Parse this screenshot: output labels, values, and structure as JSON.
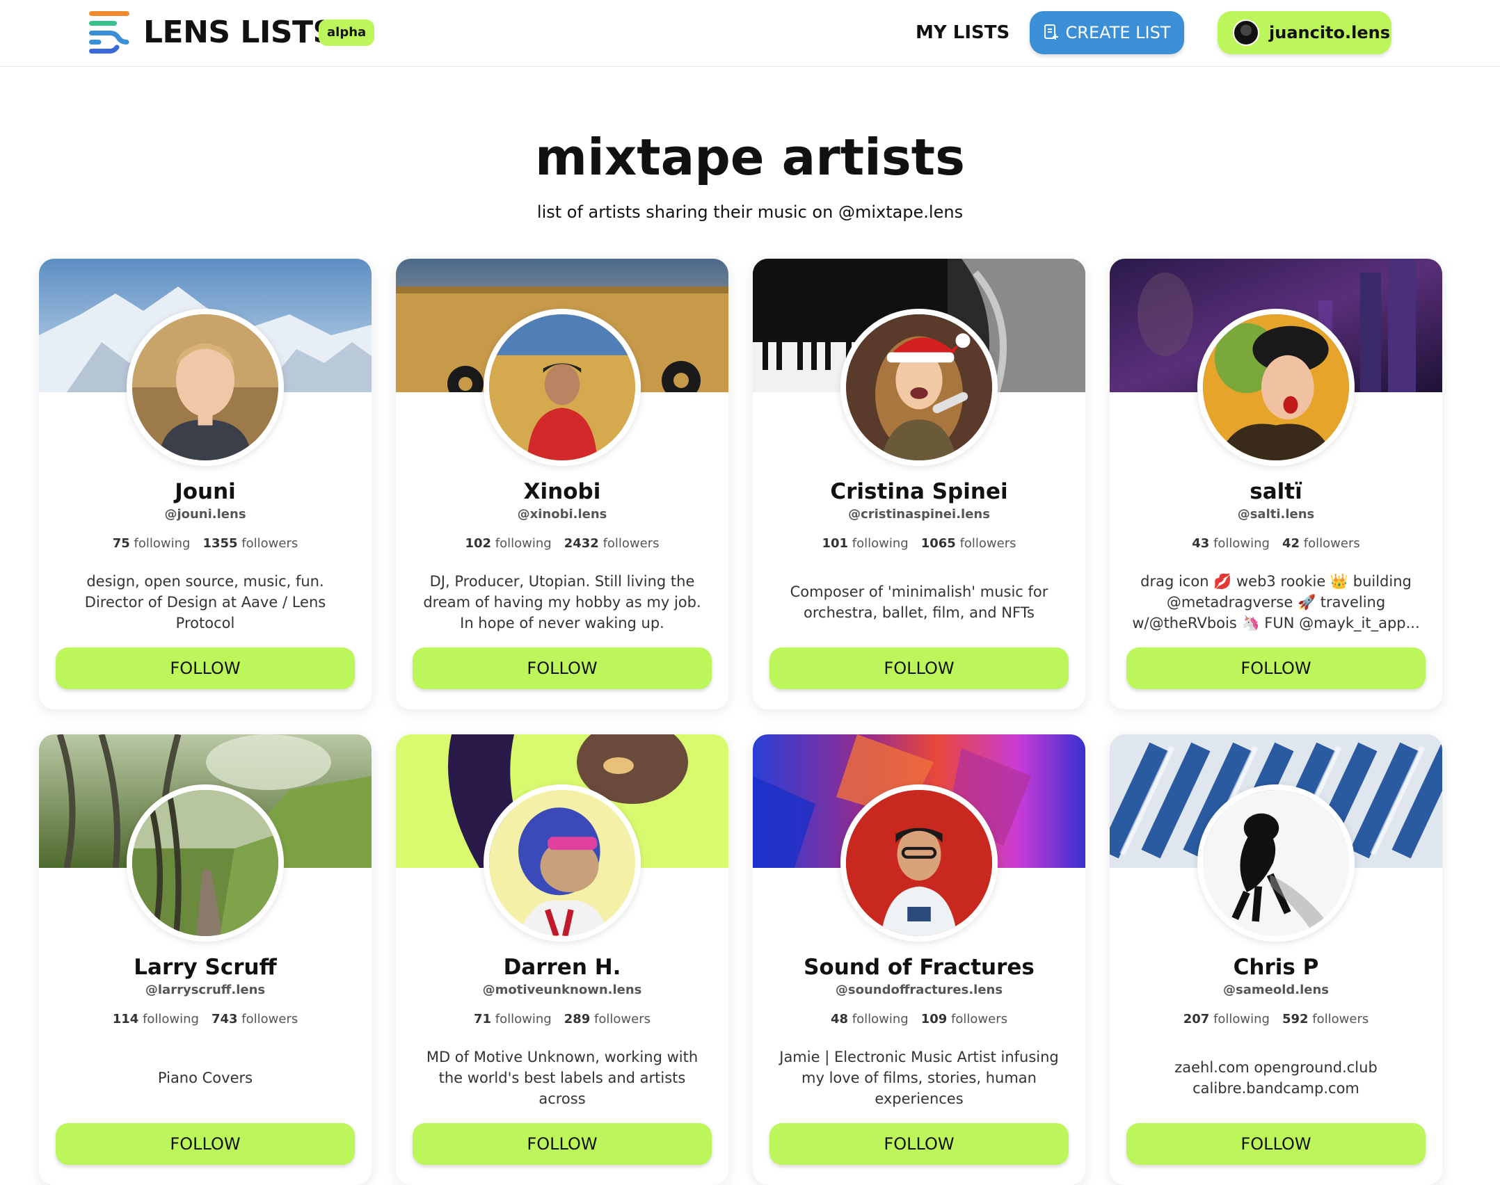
{
  "header": {
    "brand": "LENS LISTS",
    "badge": "alpha",
    "nav_my_lists": "MY LISTS",
    "create_list": "CREATE LIST",
    "user_handle": "juancito.lens",
    "colors": {
      "accent_green": "#bdf65a",
      "primary_blue": "#3b8fd6"
    }
  },
  "list": {
    "title": "mixtape artists",
    "description": "list of artists sharing their music on @mixtape.lens"
  },
  "cards": [
    {
      "name": "Jouni",
      "handle": "@jouni.lens",
      "following": "75",
      "followers": "1355",
      "following_label": "following",
      "followers_label": "followers",
      "bio": "design, open source, music, fun. Director of Design at Aave / Lens Protocol",
      "follow_label": "FOLLOW"
    },
    {
      "name": "Xinobi",
      "handle": "@xinobi.lens",
      "following": "102",
      "followers": "2432",
      "following_label": "following",
      "followers_label": "followers",
      "bio": "DJ, Producer, Utopian. Still living the dream of having my hobby as my job. In hope of never waking up.",
      "follow_label": "FOLLOW"
    },
    {
      "name": "Cristina Spinei",
      "handle": "@cristinaspinei.lens",
      "following": "101",
      "followers": "1065",
      "following_label": "following",
      "followers_label": "followers",
      "bio": "Composer of 'minimalish' music for orchestra, ballet, film, and NFTs",
      "follow_label": "FOLLOW"
    },
    {
      "name": "saltï",
      "handle": "@salti.lens",
      "following": "43",
      "followers": "42",
      "following_label": "following",
      "followers_label": "followers",
      "bio": "drag icon 💋 web3 rookie 👑 building @metadragverse 🚀 traveling w/@theRVbois 🦄 FUN @mayk_it_app...",
      "follow_label": "FOLLOW"
    },
    {
      "name": "Larry Scruff",
      "handle": "@larryscruff.lens",
      "following": "114",
      "followers": "743",
      "following_label": "following",
      "followers_label": "followers",
      "bio": "Piano Covers",
      "follow_label": "FOLLOW"
    },
    {
      "name": "Darren H.",
      "handle": "@motiveunknown.lens",
      "following": "71",
      "followers": "289",
      "following_label": "following",
      "followers_label": "followers",
      "bio": "MD of Motive Unknown, working with the world's best labels and artists across",
      "follow_label": "FOLLOW"
    },
    {
      "name": "Sound of Fractures",
      "handle": "@soundoffractures.lens",
      "following": "48",
      "followers": "109",
      "following_label": "following",
      "followers_label": "followers",
      "bio": "Jamie | Electronic Music Artist infusing my love of films, stories, human experiences",
      "follow_label": "FOLLOW"
    },
    {
      "name": "Chris P",
      "handle": "@sameold.lens",
      "following": "207",
      "followers": "592",
      "following_label": "following",
      "followers_label": "followers",
      "bio": "zaehl.com openground.club calibre.bandcamp.com",
      "follow_label": "FOLLOW"
    }
  ]
}
